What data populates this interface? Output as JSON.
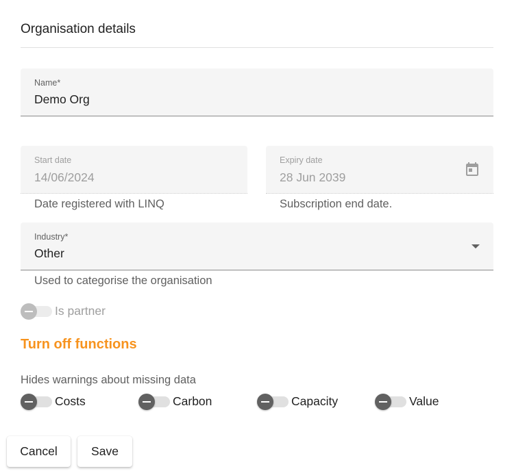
{
  "dialog": {
    "title": "Organisation details"
  },
  "name_field": {
    "label": "Name*",
    "value": "Demo Org"
  },
  "start_date": {
    "label": "Start date",
    "value": "14/06/2024",
    "hint": "Date registered with LINQ"
  },
  "expiry_date": {
    "label": "Expiry date",
    "value": "28 Jun 2039",
    "hint": "Subscription end date.",
    "icon": "calendar-icon"
  },
  "industry": {
    "label": "Industry*",
    "value": "Other",
    "hint": "Used to categorise the organisation",
    "icon": "dropdown-arrow-icon"
  },
  "partner_toggle": {
    "label": "Is partner",
    "checked": false,
    "disabled": true
  },
  "functions": {
    "heading": "Turn off functions",
    "heading_color": "#f7931e",
    "description": "Hides warnings about missing data",
    "toggles": [
      {
        "label": "Costs",
        "checked": false
      },
      {
        "label": "Carbon",
        "checked": false
      },
      {
        "label": "Capacity",
        "checked": false
      },
      {
        "label": "Value",
        "checked": false
      }
    ]
  },
  "actions": {
    "cancel_label": "Cancel",
    "save_label": "Save"
  }
}
